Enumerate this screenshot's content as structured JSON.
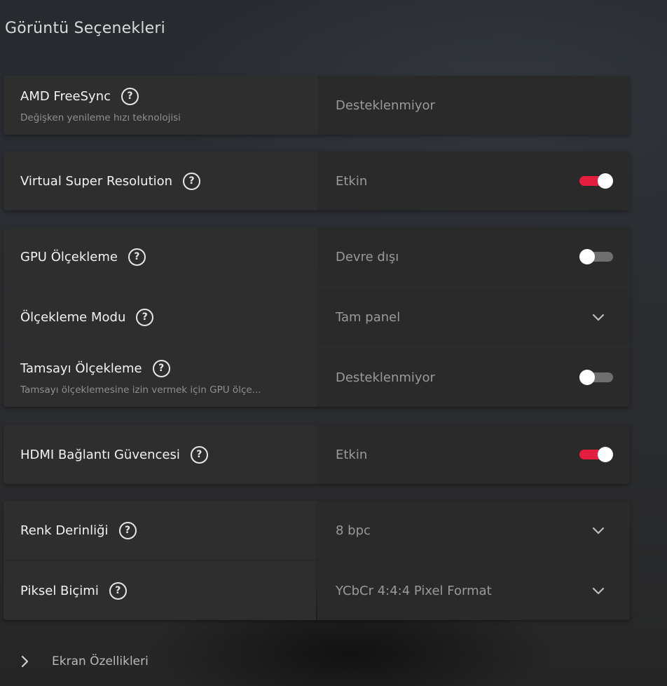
{
  "page": {
    "title": "Görüntü Seçenekleri"
  },
  "freesync": {
    "label": "AMD FreeSync",
    "description": "Değişken yenileme hızı teknolojisi",
    "value": "Desteklenmiyor"
  },
  "vsr": {
    "label": "Virtual Super Resolution",
    "value": "Etkin",
    "enabled": true
  },
  "gpu_scaling": {
    "label": "GPU Ölçekleme",
    "value": "Devre dışı",
    "enabled": false
  },
  "scaling_mode": {
    "label": "Ölçekleme Modu",
    "value": "Tam panel"
  },
  "integer_scaling": {
    "label": "Tamsayı Ölçekleme",
    "description": "Tamsayı ölçeklemesine izin vermek için GPU ölçe...",
    "value": "Desteklenmiyor",
    "enabled": false
  },
  "hdmi_link": {
    "label": "HDMI Bağlantı Güvencesi",
    "value": "Etkin",
    "enabled": true
  },
  "color_depth": {
    "label": "Renk Derinliği",
    "value": "8 bpc"
  },
  "pixel_format": {
    "label": "Piksel Biçimi",
    "value": "YCbCr 4:4:4 Pixel Format"
  },
  "footer": {
    "label": "Ekran Özellikleri"
  },
  "help_glyph": "?",
  "icons": {
    "help": "help-circle-icon",
    "dropdown": "chevron-down-icon",
    "expand": "chevron-right-icon"
  },
  "colors": {
    "accent": "#e41e3f",
    "toggle_off": "#6f6f6f"
  }
}
